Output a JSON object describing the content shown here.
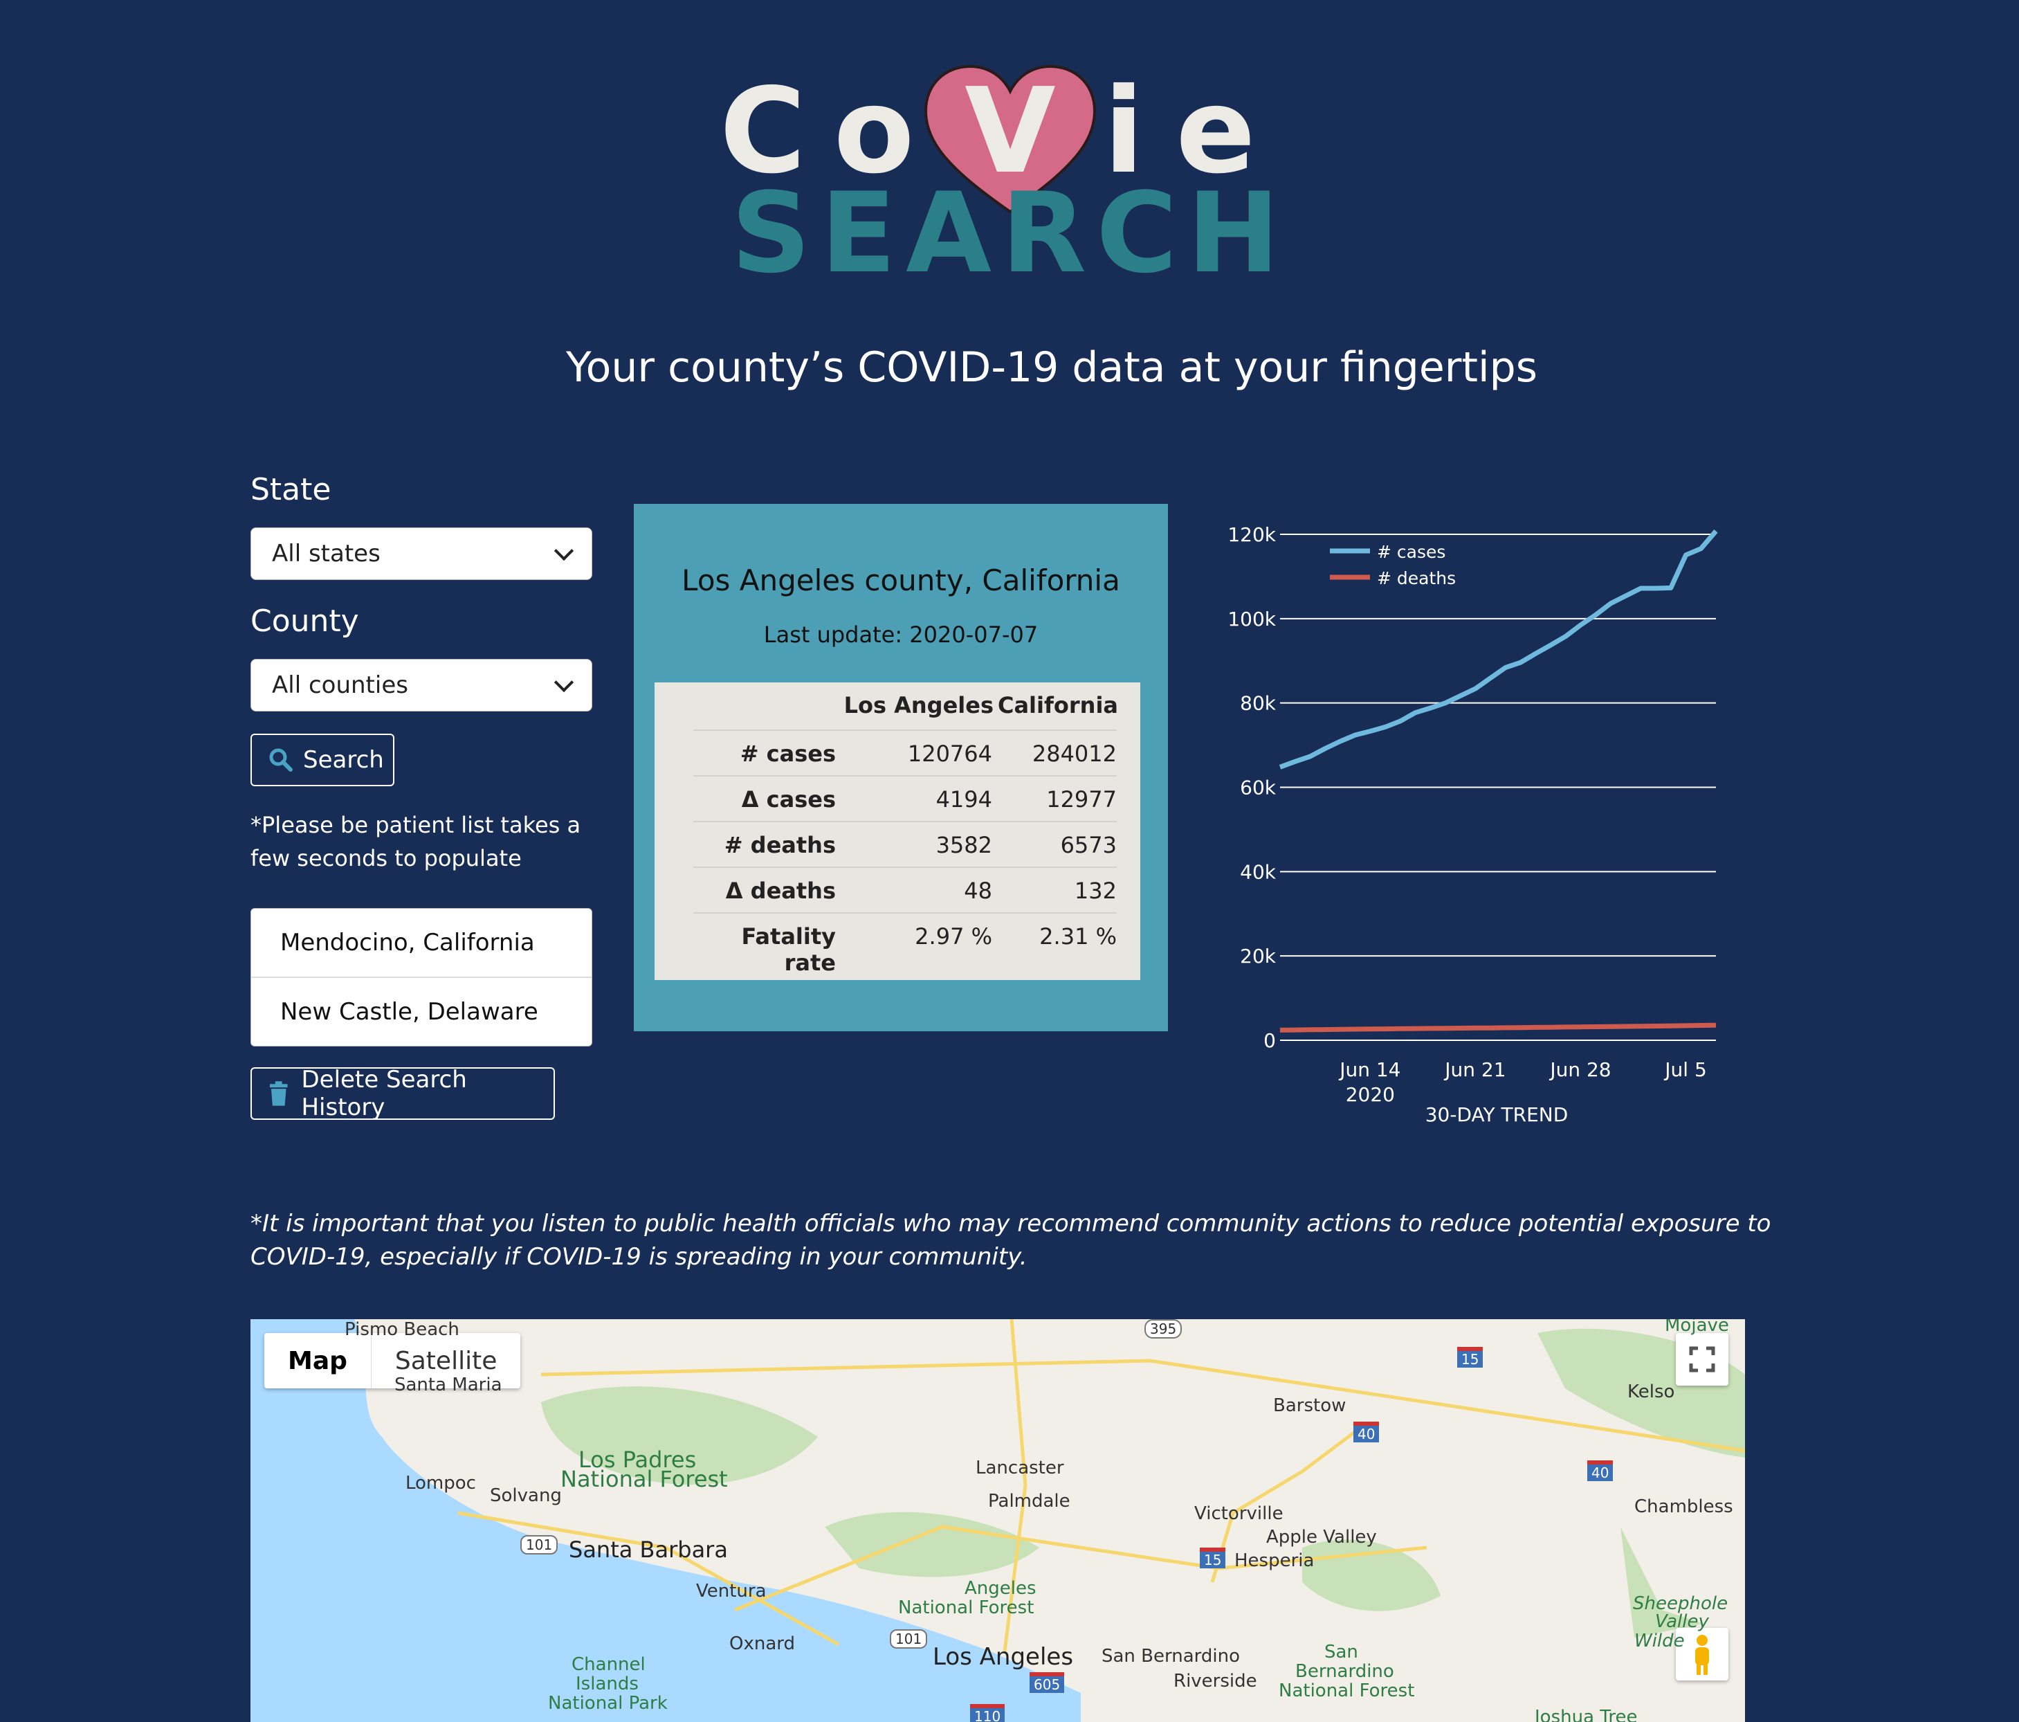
{
  "logo": {
    "line1_left": "Co",
    "line1_heart": "V",
    "line1_right": "ie",
    "line2": "SEARCH"
  },
  "tagline": "Your county’s COVID-19 data at your fingertips",
  "form": {
    "state_label": "State",
    "state_value": "All states",
    "county_label": "County",
    "county_value": "All counties",
    "search_label": "Search",
    "note": "*Please be patient list takes a few seconds to populate"
  },
  "history": [
    {
      "label": "Mendocino, California"
    },
    {
      "label": "New Castle, Delaware"
    }
  ],
  "delete_label": "Delete Search History",
  "card": {
    "title": "Los Angeles county, California",
    "last_update": "Last update: 2020-07-07",
    "col1": "Los Angeles",
    "col2": "California",
    "rows": [
      {
        "label": "# cases",
        "a": "120764",
        "b": "284012"
      },
      {
        "label": "Δ cases",
        "a": "4194",
        "b": "12977"
      },
      {
        "label": "# deaths",
        "a": "3582",
        "b": "6573"
      },
      {
        "label": "Δ deaths",
        "a": "48",
        "b": "132"
      },
      {
        "label": "Fatality rate",
        "a": "2.97 %",
        "b": "2.31 %"
      }
    ]
  },
  "chart_data": {
    "type": "line",
    "title": "30-DAY TREND",
    "x_start": "2020-06-08",
    "x": [
      "2020-06-08",
      "2020-06-09",
      "2020-06-10",
      "2020-06-11",
      "2020-06-12",
      "2020-06-13",
      "2020-06-14",
      "2020-06-15",
      "2020-06-16",
      "2020-06-17",
      "2020-06-18",
      "2020-06-19",
      "2020-06-20",
      "2020-06-21",
      "2020-06-22",
      "2020-06-23",
      "2020-06-24",
      "2020-06-25",
      "2020-06-26",
      "2020-06-27",
      "2020-06-28",
      "2020-06-29",
      "2020-06-30",
      "2020-07-01",
      "2020-07-02",
      "2020-07-03",
      "2020-07-04",
      "2020-07-05",
      "2020-07-06",
      "2020-07-07"
    ],
    "xticks": [
      {
        "date": "2020-06-14",
        "label": "Jun 14",
        "sub": "2020"
      },
      {
        "date": "2020-06-21",
        "label": "Jun 21",
        "sub": ""
      },
      {
        "date": "2020-06-28",
        "label": "Jun 28",
        "sub": ""
      },
      {
        "date": "2020-07-05",
        "label": "Jul 5",
        "sub": ""
      }
    ],
    "yticks": [
      {
        "v": 0,
        "label": "0"
      },
      {
        "v": 20000,
        "label": "20k"
      },
      {
        "v": 40000,
        "label": "40k"
      },
      {
        "v": 60000,
        "label": "60k"
      },
      {
        "v": 80000,
        "label": "80k"
      },
      {
        "v": 100000,
        "label": "100k"
      },
      {
        "v": 120000,
        "label": "120k"
      }
    ],
    "ylim": [
      0,
      120000
    ],
    "series": [
      {
        "name": "# cases",
        "color": "#6fb9df",
        "values": [
          64800,
          66100,
          67300,
          69200,
          70900,
          72400,
          73300,
          74300,
          75700,
          77700,
          78800,
          80000,
          81700,
          83400,
          85900,
          88400,
          89600,
          91700,
          93700,
          95800,
          98500,
          100900,
          103600,
          105400,
          107200,
          107200,
          107300,
          115100,
          116600,
          120764
        ]
      },
      {
        "name": "# deaths",
        "color": "#cf5b4f",
        "values": [
          2400,
          2450,
          2500,
          2530,
          2570,
          2620,
          2660,
          2700,
          2740,
          2780,
          2810,
          2840,
          2870,
          2900,
          2930,
          2970,
          3010,
          3050,
          3090,
          3130,
          3170,
          3200,
          3240,
          3280,
          3320,
          3360,
          3400,
          3460,
          3534,
          3582
        ]
      }
    ],
    "legend": "top-left"
  },
  "disclaimer": "*It is important that you listen to public health officials who may recommend community actions to reduce potential exposure to COVID-19, especially if COVID-19 is spreading in your community.",
  "map": {
    "tab_map": "Map",
    "tab_satellite": "Satellite",
    "labels": [
      "Pismo Beach",
      "Santa Maria",
      "Lompoc",
      "Solvang",
      "Los Padres",
      "National Forest",
      "Santa Barbara",
      "Ventura",
      "Oxnard",
      "Channel",
      "Islands",
      "National Park",
      "Lancaster",
      "Palmdale",
      "Angeles",
      "National Forest",
      "Los Angeles",
      "San Bernardino",
      "Riverside",
      "Victorville",
      "Apple Valley",
      "Hesperia",
      "Barstow",
      "San",
      "Bernardino",
      "National Forest",
      "Kelso",
      "Chambless",
      "Sheephole",
      "Valley",
      "Wilde",
      "Mojave",
      "Joshua Tree",
      "395",
      "15",
      "40",
      "40",
      "101",
      "101",
      "15",
      "605",
      "110"
    ]
  }
}
